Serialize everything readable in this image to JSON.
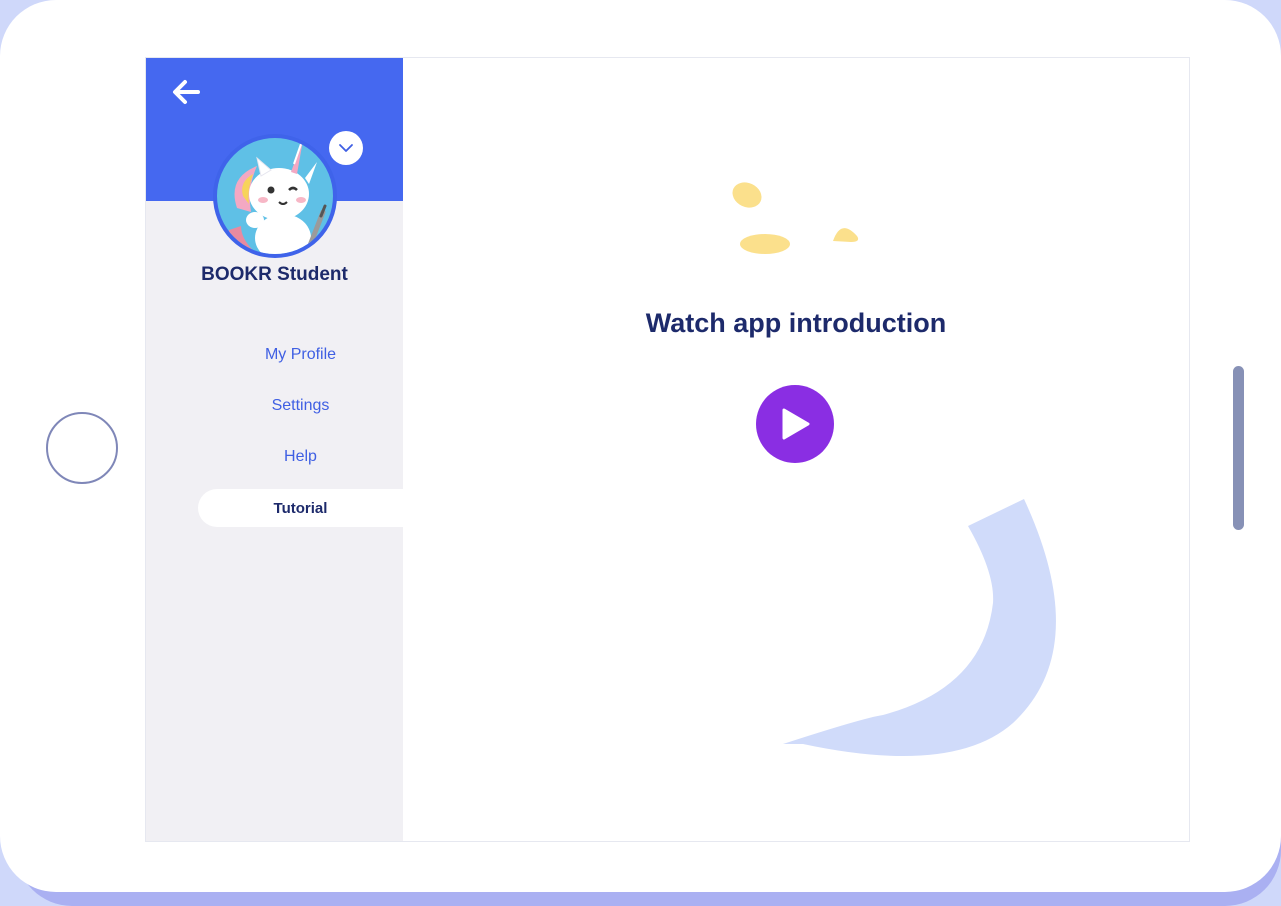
{
  "app": {
    "accent_color": "#4568f0",
    "play_color": "#8a2ee3",
    "heading_color": "#1d2a6b"
  },
  "sidebar": {
    "back_icon": "arrow-left-icon",
    "avatar_icon": "unicorn-avatar",
    "toggle_icon": "chevron-down-icon",
    "user_name": "BOOKR Student",
    "items": [
      {
        "label": "My Profile",
        "active": false
      },
      {
        "label": "Settings",
        "active": false
      },
      {
        "label": "Help",
        "active": false
      },
      {
        "label": "Tutorial",
        "active": true
      }
    ]
  },
  "main": {
    "title": "Watch app introduction",
    "play_icon": "play-icon"
  }
}
